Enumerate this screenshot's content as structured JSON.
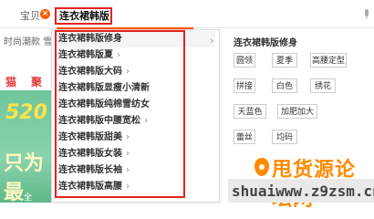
{
  "search": {
    "scope_label": "宝贝",
    "query": "连衣裙韩版"
  },
  "background": {
    "hot_label": "时尚潮款  雪",
    "nav_1": "猫",
    "nav_2": "聚划",
    "banner_num": "520",
    "banner_text": "只为最",
    "banner_small": "全"
  },
  "suggestions": [
    {
      "label": "连衣裙韩版修身",
      "has_sub": false,
      "active": true
    },
    {
      "label": "连衣裙韩版夏",
      "has_sub": true
    },
    {
      "label": "连衣裙韩版大码",
      "has_sub": true
    },
    {
      "label": "连衣裙韩版显瘦小清新",
      "has_sub": false
    },
    {
      "label": "连衣裙韩版纯棉雪纺女",
      "has_sub": false
    },
    {
      "label": "连衣裙韩版中腰宽松",
      "has_sub": true
    },
    {
      "label": "连衣裙韩版甜美",
      "has_sub": true
    },
    {
      "label": "连衣裙韩版女装",
      "has_sub": true
    },
    {
      "label": "连衣裙韩版长袖",
      "has_sub": true
    },
    {
      "label": "连衣裙韩版高腰",
      "has_sub": true
    }
  ],
  "detail": {
    "title": "连衣裙韩版修身",
    "tags": [
      "圆领",
      "夏季",
      "高腰定型",
      "拼接",
      "白色",
      "绣花",
      "天蓝色",
      "加肥加大",
      "蕾丝",
      "均码"
    ]
  },
  "watermark": {
    "big": "甩货源论坛网",
    "url": "shuaiwww.z9zsm.cn"
  }
}
